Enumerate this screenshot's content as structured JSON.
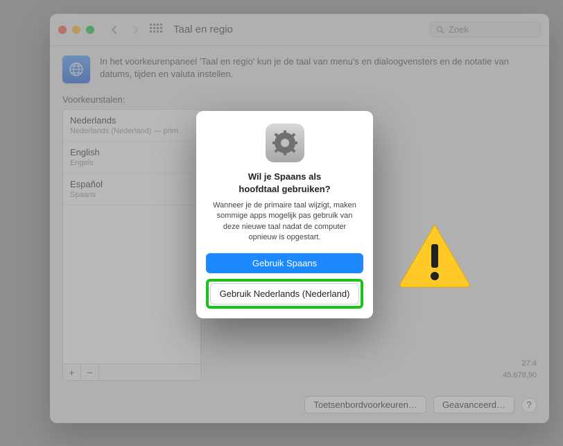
{
  "window": {
    "title": "Taal en regio",
    "search_placeholder": "Zoek",
    "header_text": "In het voorkeurenpaneel 'Taal en regio' kun je de taal van menu's en dialoogvensters en de notatie van datums, tijden en valuta instellen."
  },
  "left": {
    "label": "Voorkeurstalen:",
    "languages": [
      {
        "name": "Nederlands",
        "sub": "Nederlands (Nederland) — prim"
      },
      {
        "name": "English",
        "sub": "Engels"
      },
      {
        "name": "Español",
        "sub": "Spaans"
      }
    ],
    "add": "+",
    "remove": "−"
  },
  "right": {
    "sample_time": "27:4",
    "sample_number": "45.678,90"
  },
  "footer": {
    "keyboard_btn": "Toetsenbordvoorkeuren…",
    "advanced_btn": "Geavanceerd…",
    "help": "?"
  },
  "modal": {
    "title_line1": "Wil je Spaans als",
    "title_line2": "hoofdtaal gebruiken?",
    "body": "Wanneer je de primaire taal wijzigt, maken sommige apps mogelijk pas gebruik van deze nieuwe taal nadat de computer opnieuw is opgestart.",
    "primary_btn": "Gebruik Spaans",
    "secondary_btn": "Gebruik Nederlands (Nederland)"
  }
}
